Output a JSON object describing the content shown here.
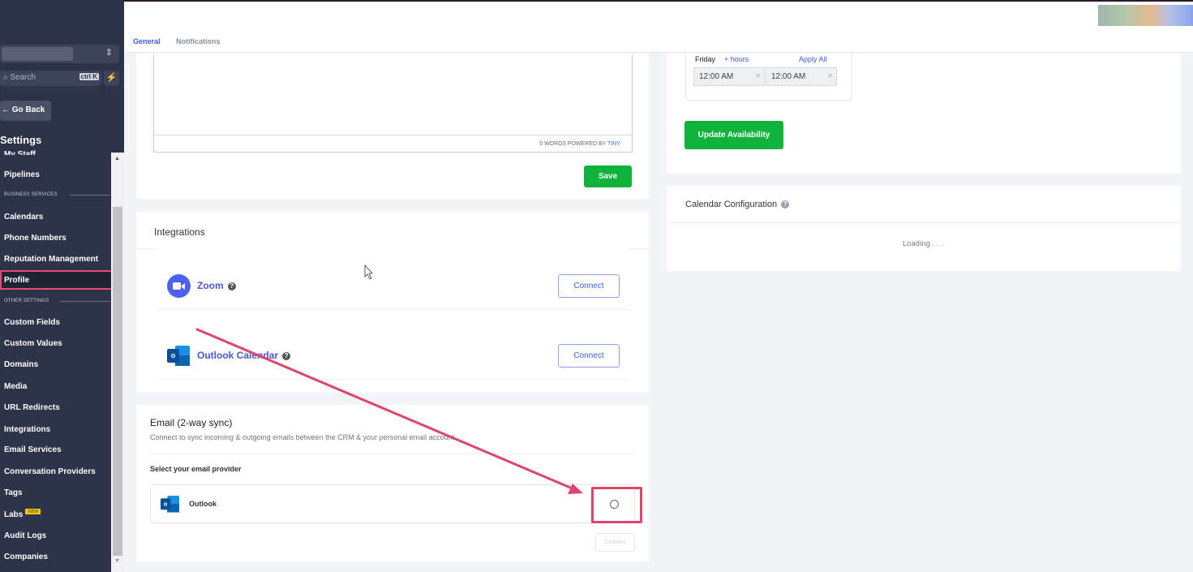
{
  "sidebar": {
    "search": {
      "placeholder": "Search",
      "shortcut": "ctrl K"
    },
    "go_back": "← Go Back",
    "settings_title": "Settings",
    "items_top": [
      "My Staff",
      "Pipelines"
    ],
    "section_business": "BUSINESS SERVICES",
    "business_items": [
      "Calendars",
      "Phone Numbers",
      "Reputation Management",
      "Profile"
    ],
    "section_other": "OTHER SETTINGS",
    "other_items": [
      "Custom Fields",
      "Custom Values",
      "Domains",
      "Media",
      "URL Redirects",
      "Integrations",
      "Email Services",
      "Conversation Providers",
      "Tags",
      "Labs",
      "Audit Logs",
      "Companies"
    ],
    "labs_badge": "new",
    "active_item": "Profile"
  },
  "tabs": {
    "general": "General",
    "notifications": "Notifications",
    "active": "General"
  },
  "editor": {
    "footer_words": "0 WORDS POWERED BY ",
    "footer_tiny": "TINY"
  },
  "save_button": "Save",
  "integrations": {
    "title": "Integrations",
    "rows": [
      {
        "name": "Zoom",
        "button": "Connect",
        "icon": "zoom-icon"
      },
      {
        "name": "Outlook Calendar",
        "button": "Connect",
        "icon": "outlook-icon"
      }
    ]
  },
  "email_sync": {
    "title": "Email (2-way sync)",
    "subtitle": "Connect to sync incoming & outgoing emails between the CRM & your personal email account",
    "select_label": "Select your email provider",
    "provider": "Outlook",
    "connect_button": "Connect"
  },
  "availability": {
    "day": "Friday",
    "add_hours": "+ hours",
    "apply_all": "Apply All",
    "start_time": "12:00 AM",
    "end_time": "12:00 AM",
    "update_button": "Update Availability"
  },
  "calendar_config": {
    "title": "Calendar Configuration",
    "loading": "Loading . . ."
  },
  "colors": {
    "accent": "#3a5ee6",
    "success": "#0fb33b",
    "sidebar_bg": "#2d3348",
    "highlight": "#e0446b"
  }
}
